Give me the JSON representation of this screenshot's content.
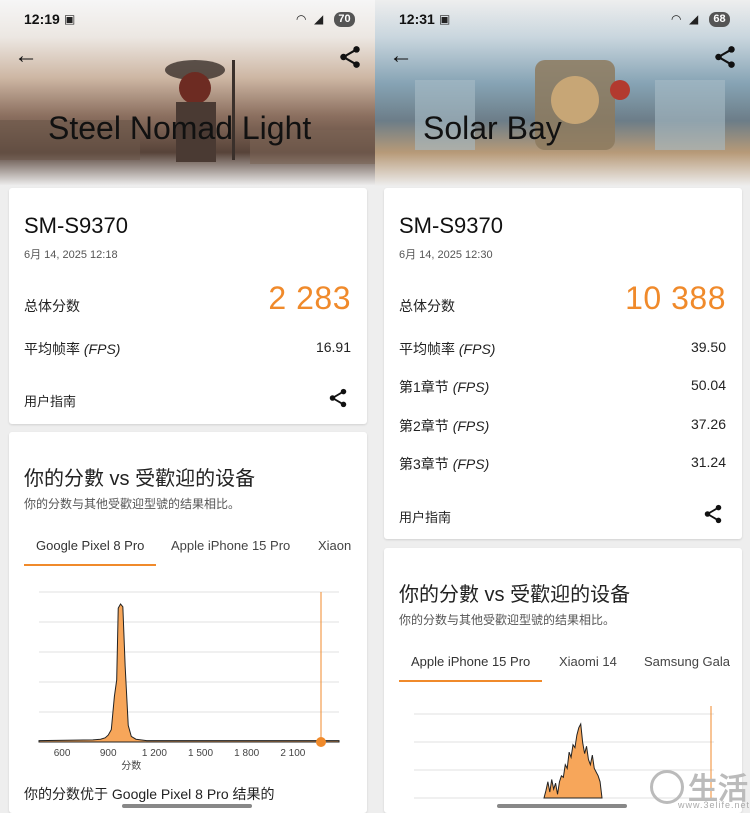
{
  "accent_color": "#f08a2b",
  "left": {
    "status": {
      "time": "12:19",
      "battery": "70"
    },
    "hero_title": "Steel Nomad Light",
    "device": "SM-S9370",
    "date": "6月 14, 2025 12:18",
    "total_label": "总体分数",
    "total_value": "2 283",
    "rows": [
      {
        "label": "平均帧率",
        "unit": "(FPS)",
        "value": "16.91"
      }
    ],
    "guide_label": "用户指南",
    "compare": {
      "title": "你的分數 vs 受歡迎的设备",
      "subtitle": "你的分数与其他受歡迎型號的结果相比。",
      "tabs": [
        "Google Pixel 8 Pro",
        "Apple iPhone 15 Pro",
        "Xiaon"
      ],
      "active_tab": 0,
      "bottom_text": "你的分数优于 Google Pixel 8 Pro 结果的"
    },
    "chart_data": {
      "type": "area",
      "title": "",
      "xlabel": "分数",
      "ylabel": "",
      "xlim": [
        450,
        2400
      ],
      "x_ticks": [
        600,
        900,
        1200,
        1500,
        1800,
        2100
      ],
      "x_tick_labels": [
        "600",
        "900",
        "1 200",
        "1 500",
        "1 800",
        "2 100"
      ],
      "grid": true,
      "distribution": {
        "x": [
          450,
          800,
          850,
          880,
          900,
          920,
          940,
          955,
          965,
          980,
          995,
          1010,
          1030,
          1050,
          1080,
          1150,
          2400
        ],
        "y": [
          0.01,
          0.015,
          0.02,
          0.03,
          0.05,
          0.09,
          0.33,
          0.45,
          0.97,
          1.0,
          0.98,
          0.55,
          0.12,
          0.04,
          0.02,
          0.01,
          0.01
        ]
      },
      "your_score": 2283,
      "your_score_color": "#f08a2b"
    }
  },
  "right": {
    "status": {
      "time": "12:31",
      "battery": "68"
    },
    "hero_title": "Solar Bay",
    "device": "SM-S9370",
    "date": "6月 14, 2025 12:30",
    "total_label": "总体分数",
    "total_value": "10 388",
    "rows": [
      {
        "label": "平均帧率",
        "unit": "(FPS)",
        "value": "39.50"
      },
      {
        "label": "第1章节",
        "unit": "(FPS)",
        "value": "50.04"
      },
      {
        "label": "第2章节",
        "unit": "(FPS)",
        "value": "37.26"
      },
      {
        "label": "第3章节",
        "unit": "(FPS)",
        "value": "31.24"
      }
    ],
    "guide_label": "用户指南",
    "compare": {
      "title": "你的分數 vs 受歡迎的设备",
      "subtitle": "你的分数与其他受歡迎型號的结果相比。",
      "tabs": [
        "Apple iPhone 15 Pro",
        "Xiaomi 14",
        "Samsung Gala"
      ],
      "active_tab": 0
    },
    "chart_data": {
      "type": "area",
      "title": "",
      "xlabel": "",
      "ylabel": "",
      "grid": true,
      "distribution": {
        "x": [
          0,
          1,
          2,
          3,
          4,
          5,
          6,
          7,
          8,
          9,
          10,
          11,
          12,
          13,
          14,
          15,
          16,
          17,
          18,
          19,
          20,
          21,
          22,
          23,
          24,
          25,
          26,
          27,
          28,
          29,
          30
        ],
        "y": [
          0.0,
          0.1,
          0.22,
          0.08,
          0.25,
          0.12,
          0.2,
          0.05,
          0.22,
          0.3,
          0.28,
          0.45,
          0.4,
          0.62,
          0.55,
          0.72,
          0.68,
          0.85,
          0.95,
          1.0,
          0.75,
          0.6,
          0.7,
          0.52,
          0.45,
          0.58,
          0.4,
          0.35,
          0.3,
          0.22,
          0.0
        ]
      },
      "your_score_marker": true,
      "your_score_color": "#f08a2b"
    }
  },
  "watermark": {
    "text": "生活",
    "url": "www.3elife.net"
  }
}
